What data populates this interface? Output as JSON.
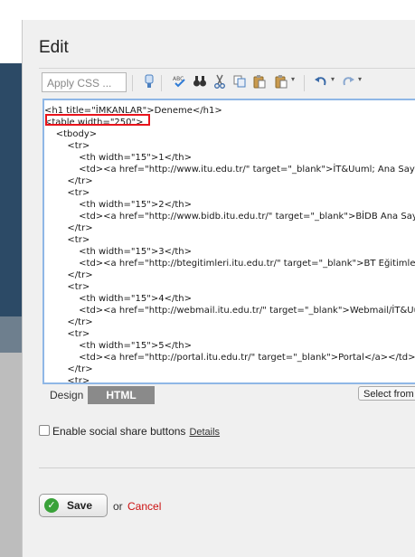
{
  "dialog": {
    "title": "Edit"
  },
  "toolbar": {
    "css_select_placeholder": "Apply CSS ...",
    "icons": [
      "style-icon",
      "spellcheck-icon",
      "find-icon",
      "cut-icon",
      "copy-icon",
      "paste-icon",
      "paste-special-icon",
      "undo-icon",
      "redo-icon"
    ]
  },
  "editor": {
    "lines": [
      "<h1 title=\"İMKANLAR\">Deneme</h1>",
      "<table width=\"250\">",
      "    <tbody>",
      "        <tr>",
      "            <th width=\"15\">1</th>",
      "            <td><a href=\"http://www.itu.edu.tr/\" target=\"_blank\">İT&Uuml; Ana Sayfa",
      "        </tr>",
      "        <tr>",
      "            <th width=\"15\">2</th>",
      "            <td><a href=\"http://www.bidb.itu.edu.tr/\" target=\"_blank\">BİDB Ana Sayfa",
      "        </tr>",
      "        <tr>",
      "            <th width=\"15\">3</th>",
      "            <td><a href=\"http://btegitimleri.itu.edu.tr/\" target=\"_blank\">BT Eğitimleri",
      "        </tr>",
      "        <tr>",
      "            <th width=\"15\">4</th>",
      "            <td><a href=\"http://webmail.itu.edu.tr/\" target=\"_blank\">Webmail/İT&Uuml;",
      "        </tr>",
      "        <tr>",
      "            <th width=\"15\">5</th>",
      "            <td><a href=\"http://portal.itu.edu.tr/\" target=\"_blank\">Portal</a></td>",
      "        </tr>",
      "        <tr>"
    ],
    "highlight_color": "#e8141c"
  },
  "mode_tabs": {
    "design": "Design",
    "html": "HTML"
  },
  "select_from": "Select from",
  "social": {
    "label": "Enable social share buttons",
    "details": "Details"
  },
  "actions": {
    "save": "Save",
    "or": "or",
    "cancel": "Cancel"
  }
}
